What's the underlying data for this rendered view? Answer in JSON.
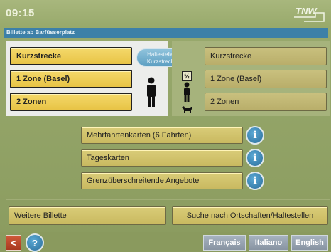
{
  "header": {
    "time": "09:15",
    "logo_text": "TNW"
  },
  "title_bar": {
    "text": "Billette ab Barfüsserplatz"
  },
  "left_panel": {
    "buttons": [
      "Kurzstrecke",
      "1 Zone (Basel)",
      "2 Zonen"
    ]
  },
  "center": {
    "pill_label": "Haltestellen Kurzstrecke"
  },
  "right_panel": {
    "half_label": "½",
    "buttons": [
      "Kurzstrecke",
      "1 Zone (Basel)",
      "2 Zonen"
    ]
  },
  "middle_options": {
    "items": [
      "Mehrfahrtenkarten (6 Fahrten)",
      "Tageskarten",
      "Grenzüberschreitende Angebote"
    ]
  },
  "bottom_actions": {
    "left": "Weitere Billette",
    "right": "Suche nach Ortschaften/Haltestellen"
  },
  "footer": {
    "back": "<",
    "help": "?",
    "languages": [
      "Français",
      "Italiano",
      "English"
    ]
  },
  "colors": {
    "accent_yellow": "#f0d25e",
    "title_blue": "#3d80a8",
    "bg_green": "#9aab6e"
  }
}
